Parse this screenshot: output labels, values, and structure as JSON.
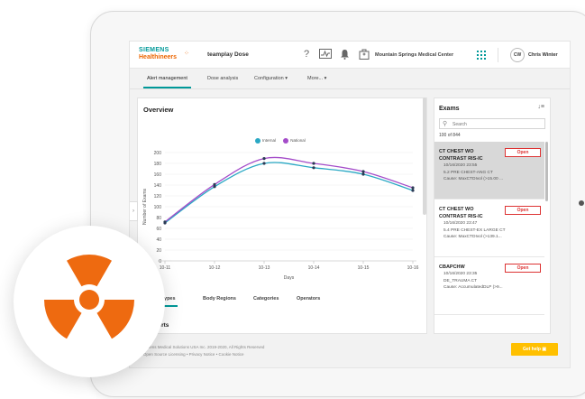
{
  "header": {
    "brand_line1": "SIEMENS",
    "brand_line2": "Healthineers",
    "app_name": "teamplay Dose",
    "organization": "Mountain Springs Medical Center",
    "user_initials": "CW",
    "user_name": "Chris Winter"
  },
  "nav": {
    "items": [
      {
        "label": "Alert management"
      },
      {
        "label": "Dose analysis"
      },
      {
        "label": "Configuration ▾"
      },
      {
        "label": "More... ▾"
      }
    ]
  },
  "overview": {
    "title": "Overview",
    "tabs": [
      {
        "label": "...lity Types"
      },
      {
        "label": "Body Regions"
      },
      {
        "label": "Categories"
      },
      {
        "label": "Operators"
      }
    ],
    "alerts_title": "...l alerts"
  },
  "chart_data": {
    "type": "line",
    "categories": [
      "10-11",
      "10-12",
      "10-13",
      "10-14",
      "10-15",
      "10-16"
    ],
    "series": [
      {
        "name": "Internal",
        "color": "#2aa8c4",
        "values": [
          70,
          137,
          180,
          172,
          160,
          130
        ]
      },
      {
        "name": "National",
        "color": "#a44cc9",
        "values": [
          72,
          141,
          189,
          180,
          165,
          135
        ]
      }
    ],
    "ylim": [
      0,
      200
    ],
    "yticks": [
      0,
      20,
      40,
      60,
      80,
      100,
      120,
      140,
      160,
      180,
      200
    ],
    "xlabel": "Days",
    "ylabel": "Number of Exams",
    "legend": "top-center",
    "grid": true
  },
  "exams": {
    "title": "Exams",
    "search_placeholder": "Search",
    "count": "100 of 844",
    "open_label": "Open",
    "items": [
      {
        "name": "CT CHEST WO CONTRAST RIS-IC",
        "date": "10/16/2020 23:55",
        "protocol": "5.2 PRE CHEST-ANG CT",
        "cause": "Cause: MaxCTDIvol (>15.00 ..."
      },
      {
        "name": "CT CHEST WO CONTRAST RIS-IC",
        "date": "10/16/2020 23:47",
        "protocol": "5.4 PRE CHEST-EX LARGE CT",
        "cause": "Cause: MaxCTDIvol (>139.1..."
      },
      {
        "name": "CBAPCHW",
        "date": "10/16/2020 23:35",
        "protocol": "DE_TRAUMA CT",
        "cause": "Cause: AccumulatedDLP (>9..."
      }
    ]
  },
  "footer": {
    "copyright": "Siemens Medical Solutions USA Inc. 2019-2020, All Rights Reserved",
    "links": "•  Open Source Licensing   •  Privacy Notice   •  Cookie Notice",
    "help_label": "Get help ▣"
  },
  "colors": {
    "accent": "#009999",
    "brand_orange": "#ec6602",
    "alert_red": "#dd3333",
    "help_yellow": "#ffc000",
    "radiation_orange": "#ee6a10"
  },
  "icons": [
    "help-icon",
    "activity-icon",
    "bell-icon",
    "hospital-icon",
    "apps-grid-icon",
    "sort-icon",
    "search-icon",
    "radiation-icon"
  ]
}
